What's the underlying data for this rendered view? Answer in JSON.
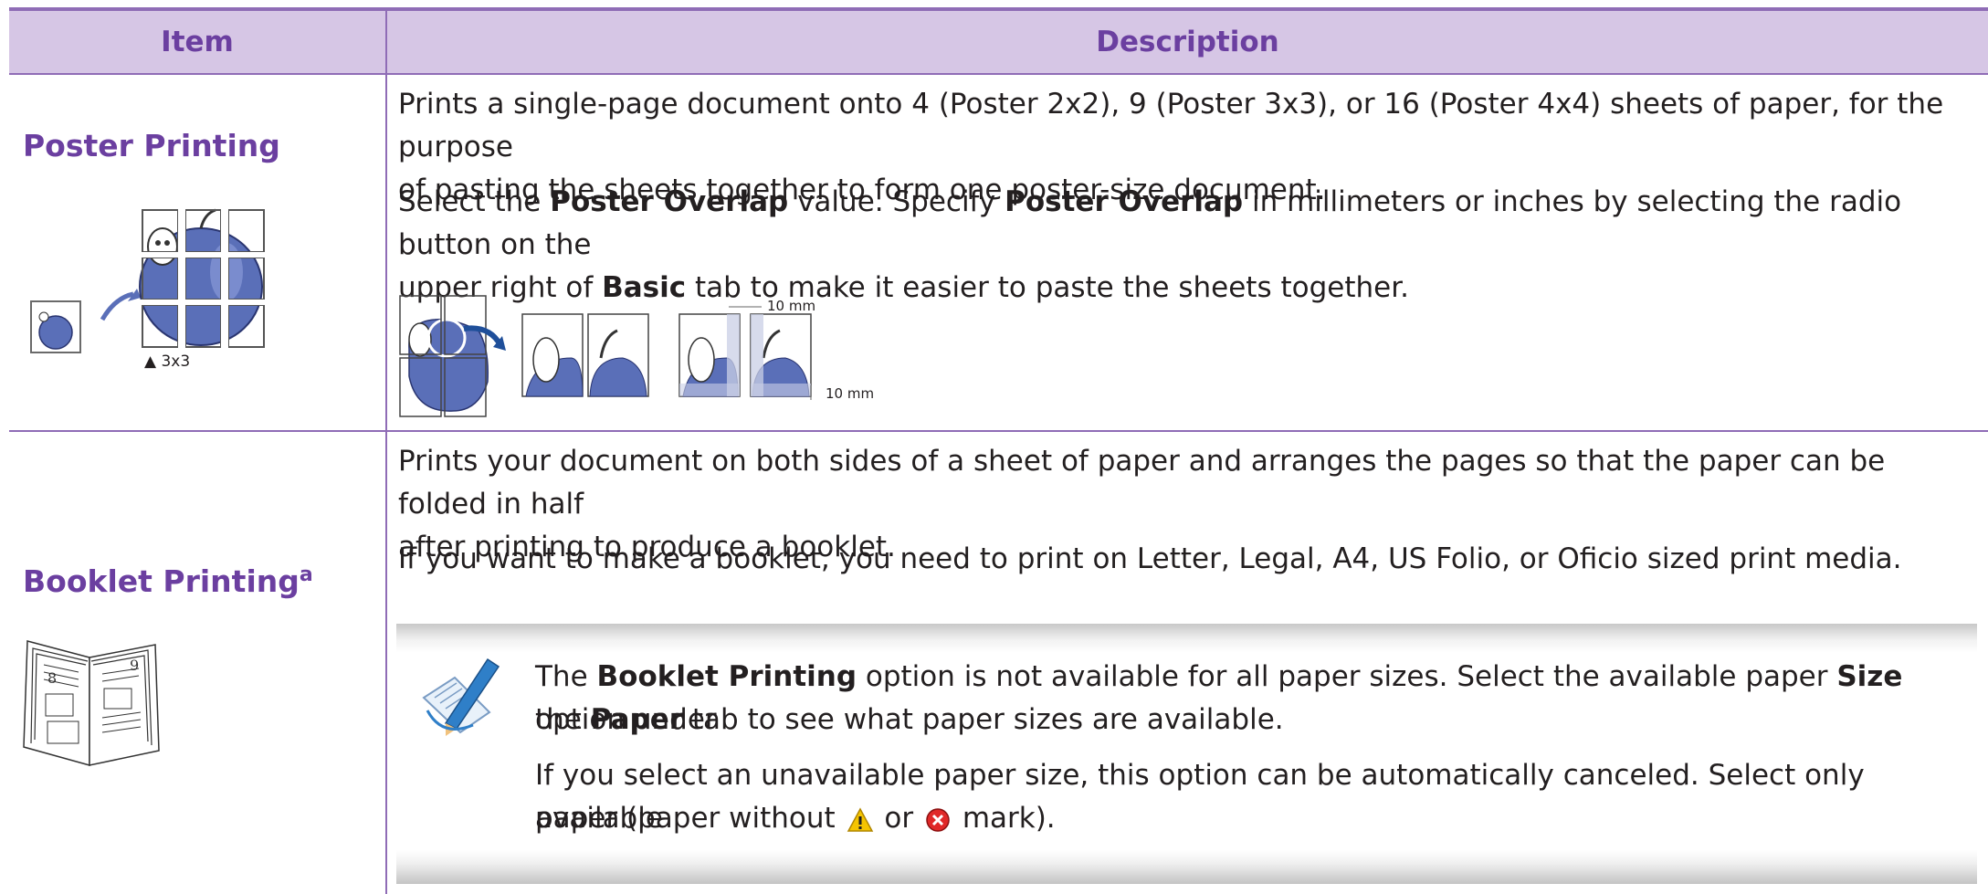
{
  "table": {
    "headers": {
      "item": "Item",
      "description": "Description"
    }
  },
  "rows": {
    "poster": {
      "title": "Poster Printing",
      "grid_caption": "▲ 3x3",
      "p1_line1": "Prints a single-page document onto 4 (Poster 2x2), 9 (Poster 3x3), or 16 (Poster 4x4) sheets of paper, for the purpose",
      "p1_line2": "of pasting the sheets together to form one poster-size document.",
      "p2_pre": "Select the ",
      "p2_b1": "Poster Overlap",
      "p2_mid1": " value. Specify ",
      "p2_b2": "Poster Overlap",
      "p2_mid2": " in millimeters or inches by selecting the radio button on the",
      "p3_pre": "upper right of ",
      "p3_b": "Basic",
      "p3_post": " tab to make it easier to paste the sheets together.",
      "overlap_top_label": "10 mm",
      "overlap_right_label": "10 mm"
    },
    "booklet": {
      "title": "Booklet Printing",
      "title_sup": "a",
      "page_left": "8",
      "page_right": "9",
      "p1_line1": "Prints your document on both sides of a sheet of paper and arranges the pages so that the paper can be folded in half",
      "p1_line2": "after printing to produce a booklet.",
      "p2": "If you want to make a booklet, you need to print on Letter, Legal, A4, US Folio, or Oficio sized print media.",
      "note": {
        "l1_pre": "The ",
        "l1_b1": "Booklet Printing",
        "l1_mid": " option is not available for all paper sizes. Select the available paper ",
        "l1_b2": "Size",
        "l1_post": " option under",
        "l2_pre": "the ",
        "l2_b": "Paper",
        "l2_post": " tab to see what paper sizes are available.",
        "l3": "If you select an unavailable paper size, this option can be automatically canceled. Select only available",
        "l4_pre": "paper (paper without ",
        "l4_mid": " or ",
        "l4_post": " mark)."
      }
    }
  },
  "icons": {
    "note_icon": "note-pencil-icon",
    "warning_icon": "warning-icon",
    "error_icon": "error-icon"
  },
  "colors": {
    "header_bg": "#d6c6e5",
    "accent": "#6b3fa0",
    "rule": "#8f6cb6",
    "apple": "#5a6fb8"
  }
}
